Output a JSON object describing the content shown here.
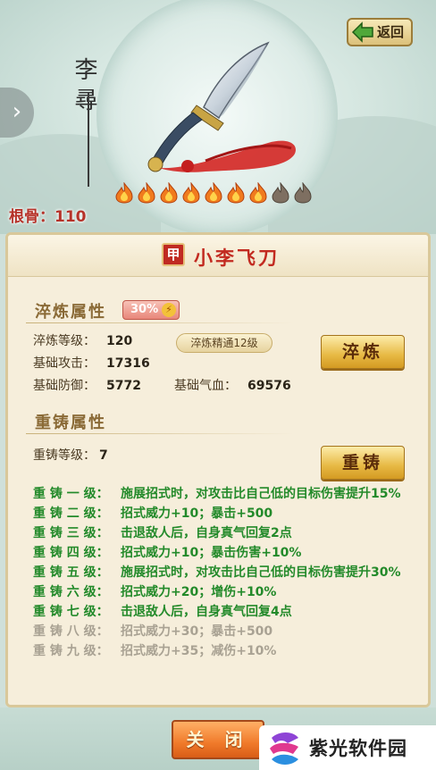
{
  "hero": {
    "calligraphy": "李 尋",
    "side_arrow": "›",
    "back_label": "返回",
    "root_label": "根骨：110",
    "gems": [
      {
        "state": "lit"
      },
      {
        "state": "lit"
      },
      {
        "state": "lit"
      },
      {
        "state": "lit"
      },
      {
        "state": "lit"
      },
      {
        "state": "lit"
      },
      {
        "state": "lit"
      },
      {
        "state": "dim"
      },
      {
        "state": "dim"
      }
    ]
  },
  "panel": {
    "badge": "甲",
    "title": "小李飞刀",
    "quench": {
      "section_title": "淬炼属性",
      "percent": "30%",
      "mastery": "淬炼精通12级",
      "button": "淬炼",
      "stats": [
        {
          "k": "淬炼等级：",
          "v": "120"
        },
        {
          "k": "基础攻击：",
          "v": "17316"
        },
        {
          "k": "基础防御：",
          "v": "5772"
        },
        {
          "k": "基础气血：",
          "v": "69576"
        }
      ]
    },
    "recast": {
      "section_title": "重铸属性",
      "level_label": "重铸等级：",
      "level_value": "7",
      "button": "重铸",
      "rows": [
        {
          "lvl": "重 铸 一 级：",
          "desc": "施展招式时，对攻击比自己低的目标伤害提升15%",
          "locked": false
        },
        {
          "lvl": "重 铸 二 级：",
          "desc": "招式威力+10；暴击+500",
          "locked": false
        },
        {
          "lvl": "重 铸 三 级：",
          "desc": "击退敌人后，自身真气回复2点",
          "locked": false
        },
        {
          "lvl": "重 铸 四 级：",
          "desc": "招式威力+10；暴击伤害+10%",
          "locked": false
        },
        {
          "lvl": "重 铸 五 级：",
          "desc": "施展招式时，对攻击比自己低的目标伤害提升30%",
          "locked": false
        },
        {
          "lvl": "重 铸 六 级：",
          "desc": "招式威力+20；增伤+10%",
          "locked": false
        },
        {
          "lvl": "重 铸 七 级：",
          "desc": "击退敌人后，自身真气回复4点",
          "locked": false
        },
        {
          "lvl": "重 铸 八 级：",
          "desc": "招式威力+30；暴击+500",
          "locked": true
        },
        {
          "lvl": "重 铸 九 级：",
          "desc": "招式威力+35；减伤+10%",
          "locked": true
        }
      ]
    }
  },
  "footer": {
    "close_label": "关 闭",
    "watermark": "紫光软件园"
  },
  "colors": {
    "title_red": "#c22a20",
    "unlocked_green": "#238a2a",
    "locked_gray": "#a9a293",
    "gold": "#e7b944"
  }
}
